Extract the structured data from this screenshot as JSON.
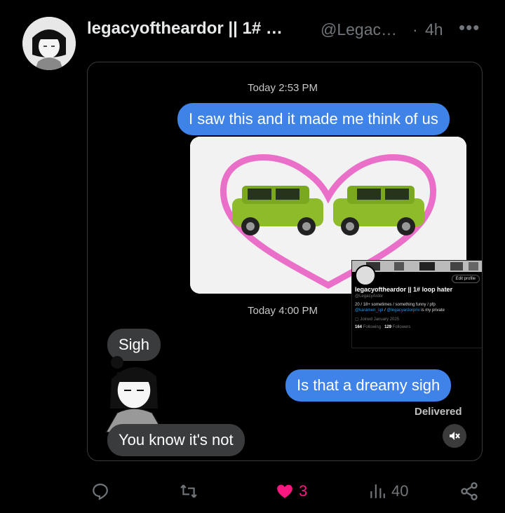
{
  "header": {
    "display_name": "legacyoftheardor || 1# …",
    "handle": "@Legac…",
    "separator": "·",
    "time": "4h",
    "more": "•••"
  },
  "conversation": {
    "timestamp_1": "Today 2:53 PM",
    "message_1": "I saw this and it made me think of us",
    "timestamp_2": "Today 4:00 PM",
    "message_2": "Sigh",
    "message_3": "Is that a dreamy sigh",
    "status": "Delivered",
    "message_4": "You know it's not"
  },
  "profile_card": {
    "edit_label": "Edit profile",
    "name": "legacyoftheardor || 1# loop hater",
    "handle": "@LegacyArdor",
    "bio_1": "20 / 18+ sometimes / something funny / pfp",
    "bio_2_link_1": "@karamen_spl",
    "bio_2_sep": " / ",
    "bio_2_link_2": "@legacyardorpriv",
    "bio_2_suffix": " is my private",
    "joined": "Joined January 2025",
    "following_count": "164",
    "following_label": "Following",
    "followers_count": "129",
    "followers_label": "Followers"
  },
  "actions": {
    "likes": "3",
    "views": "40",
    "like_color": "#f91880"
  },
  "icons": [
    "reply-icon",
    "retweet-icon",
    "heart-icon",
    "views-icon",
    "share-icon",
    "mute-icon",
    "more-icon"
  ]
}
